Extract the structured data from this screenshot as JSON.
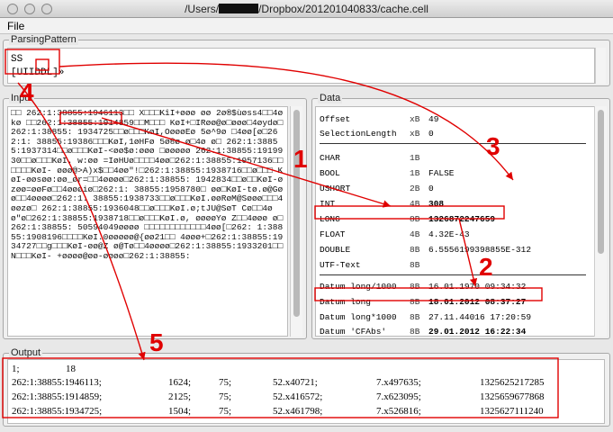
{
  "window": {
    "title_prefix": "/Users/",
    "title_suffix": "/Dropbox/201201040833/cache.cell"
  },
  "menu": {
    "file": "File"
  },
  "parsing_pattern": {
    "legend": "ParsingPattern",
    "line1": "SS",
    "line2": "[UIIDDL]»"
  },
  "input": {
    "legend": "Input",
    "text": "□□ 262:1:38855:1946113□□ X□□□KîI+øøø øø 2ø®$ùøss4□□4økø □□262:1:38855:1914859□□M□□□ KøI+□IRøø@ø□øøø□4øydø□262:1:38855: 1934725□□ø□□□KøI,OøøøEø 5ø^9ø □4øø[ø□262:1: 38855:19386□□□KøI,1øHFø 5ø®ø ø□4ø ø□ 262:1:38855:1937314□□ø□□□KøI-<øø$ø:øøø □øøøøø 262:1:38855:1919930□□ø□□□KøI. w:øø =IøHUø□□□□4øø□262:1:38855:1957136□□□□□□KøI- øøø@>A)x$□□4øø\"!□262:1:38855:1938716□□ø□□□ KøI-øøsøø:øø_ør=□□4øøøø□262:1:38855: 1942834□□ø□□KøI-øzøø=øøFø□□4øøøiø□262:1: 38855:1958780□ øø□KøI-tø.ø@Gø ø□□4øøøø□262:1: 38855:1938733□□ø□□□KøI.øøRøM@Søøø□□□4øøzø□ 262:1:38855:1936048□□ø□□□KøI.ø;tJU@SøT Cø□□4øø\"ø□262:1:38855:1938718□□ø□□□KøI.ø, øøøøYø Z□□4øøø ø□262:1:38855: 50594049øøøø □□□□□□□□□□□□4øø[□262: 1:38855:1908196□□□□KøI.0øøøøø@{øø21□□ 4øøø+□262:1:38855:1934727□□g□□□KøI-øø@Z ø@Tø□□4øøøø□262:1:38855:1933201□□N□□□KøI- +øøøø@øø-øøøø□262:1:38855:"
  },
  "data": {
    "legend": "Data",
    "rows": [
      {
        "name": "Offset",
        "size": "xB",
        "value": "49",
        "bold": false
      },
      {
        "name": "SelectionLength",
        "size": "xB",
        "value": "0",
        "bold": false
      },
      {
        "name": "CHAR",
        "size": "1B",
        "value": "",
        "bold": false
      },
      {
        "name": "BOOL",
        "size": "1B",
        "value": "FALSE",
        "bold": false
      },
      {
        "name": "USHORT",
        "size": "2B",
        "value": "0",
        "bold": false
      },
      {
        "name": "INT",
        "size": "4B",
        "value": "308",
        "bold": true
      },
      {
        "name": "LONG",
        "size": "8B",
        "value": "1326872247659",
        "bold": true
      },
      {
        "name": "FLOAT",
        "size": "4B",
        "value": "4.32E-43",
        "bold": false
      },
      {
        "name": "DOUBLE",
        "size": "8B",
        "value": "6.5556199398855E-312",
        "bold": false
      },
      {
        "name": "UTF-Text",
        "size": "8B",
        "value": "",
        "bold": false
      },
      {
        "name": "Datum long/1000",
        "size": "8B",
        "value": "16.01.1970 09:34:32",
        "bold": false
      },
      {
        "name": "Datum long",
        "size": "8B",
        "value": "18.01.2012 08:37:27",
        "bold": true
      },
      {
        "name": "Datum long*1000",
        "size": "8B",
        "value": "27.11.44016 17:20:59",
        "bold": false
      },
      {
        "name": "Datum 'CFAbs'",
        "size": "8B",
        "value": "29.01.2012 16:22:34",
        "bold": true
      }
    ]
  },
  "output": {
    "legend": "Output",
    "header": [
      "1;",
      "18"
    ],
    "rows": [
      [
        "262:1:38855:1946113;",
        "1624;",
        "75;",
        "52.x40721;",
        "7.x497635;",
        "1325625217285"
      ],
      [
        "262:1:38855:1914859;",
        "2125;",
        "75;",
        "52.x416572;",
        "7.x623095;",
        "1325659677868"
      ],
      [
        "262:1:38855:1934725;",
        "1504;",
        "75;",
        "52.x461798;",
        "7.x526816;",
        "1325627111240"
      ]
    ]
  },
  "annotations": {
    "label_1": "1",
    "label_2": "2",
    "label_3": "3",
    "label_4": "4",
    "label_5": "5",
    "color": "#e00000"
  }
}
